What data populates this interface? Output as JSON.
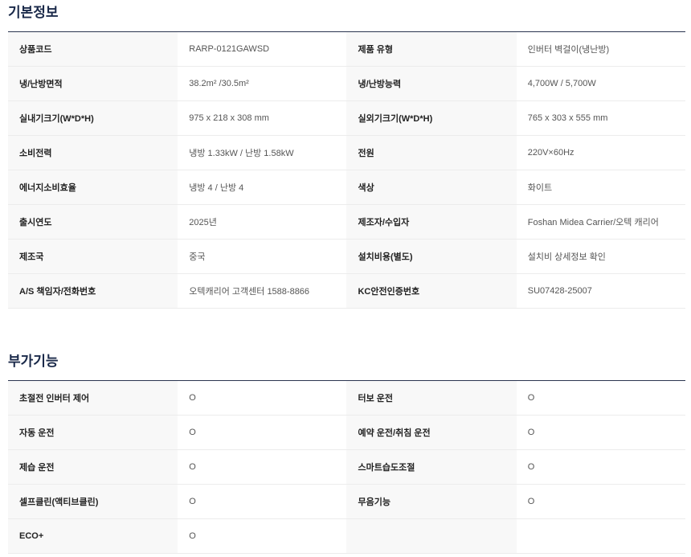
{
  "basic": {
    "title": "기본정보",
    "rows": [
      [
        {
          "label": "상품코드",
          "value": "RARP-0121GAWSD"
        },
        {
          "label": "제품 유형",
          "value": "인버터 벽걸이(냉난방)"
        }
      ],
      [
        {
          "label": "냉/난방면적",
          "value": "38.2m² /30.5m²"
        },
        {
          "label": "냉/난방능력",
          "value": "4,700W / 5,700W"
        }
      ],
      [
        {
          "label": "실내기크기(W*D*H)",
          "value": "975 x 218 x 308 mm"
        },
        {
          "label": "실외기크기(W*D*H)",
          "value": "765 x 303 x 555 mm"
        }
      ],
      [
        {
          "label": "소비전력",
          "value": "냉방 1.33kW / 난방 1.58kW"
        },
        {
          "label": "전원",
          "value": "220V×60Hz"
        }
      ],
      [
        {
          "label": "에너지소비효율",
          "value": "냉방 4 / 난방 4"
        },
        {
          "label": "색상",
          "value": "화이트"
        }
      ],
      [
        {
          "label": "출시연도",
          "value": "2025년"
        },
        {
          "label": "제조자/수입자",
          "value": "Foshan Midea Carrier/오텍 캐리어"
        }
      ],
      [
        {
          "label": "제조국",
          "value": "중국"
        },
        {
          "label": "설치비용(별도)",
          "value": "설치비 상세정보 확인"
        }
      ],
      [
        {
          "label": "A/S 책임자/전화번호",
          "value": "오텍캐리어 고객센터 1588-8866"
        },
        {
          "label": "KC안전인증번호",
          "value": "SU07428-25007"
        }
      ]
    ]
  },
  "extra": {
    "title": "부가기능",
    "rows": [
      [
        {
          "label": "초절전 인버터 제어",
          "value": "O"
        },
        {
          "label": "터보 운전",
          "value": "O"
        }
      ],
      [
        {
          "label": "자동 운전",
          "value": "O"
        },
        {
          "label": "예약 운전/취침 운전",
          "value": "O"
        }
      ],
      [
        {
          "label": "제습 운전",
          "value": "O"
        },
        {
          "label": "스마트습도조절",
          "value": "O"
        }
      ],
      [
        {
          "label": "셀프클린(액티브클린)",
          "value": "O"
        },
        {
          "label": "무음기능",
          "value": "O"
        }
      ],
      [
        {
          "label": "ECO+",
          "value": "O"
        },
        {
          "label": "",
          "value": ""
        }
      ]
    ]
  }
}
